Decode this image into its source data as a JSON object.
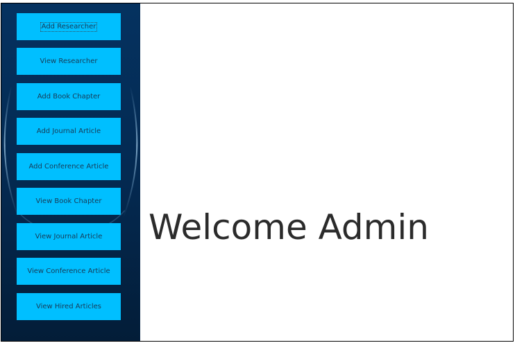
{
  "sidebar": {
    "buttons": [
      {
        "label": "Add Researcher"
      },
      {
        "label": "View Researcher"
      },
      {
        "label": "Add Book Chapter"
      },
      {
        "label": "Add Journal Article"
      },
      {
        "label": "Add Conference Article"
      },
      {
        "label": "View Book Chapter"
      },
      {
        "label": "View Journal Article"
      },
      {
        "label": "View Conference Article"
      },
      {
        "label": "View Hired Articles"
      }
    ]
  },
  "main": {
    "welcome_text": "Welcome Admin"
  },
  "colors": {
    "sidebar_bg": "#04264a",
    "button_bg": "#00bfff",
    "welcome_text": "#2b2b2b"
  }
}
